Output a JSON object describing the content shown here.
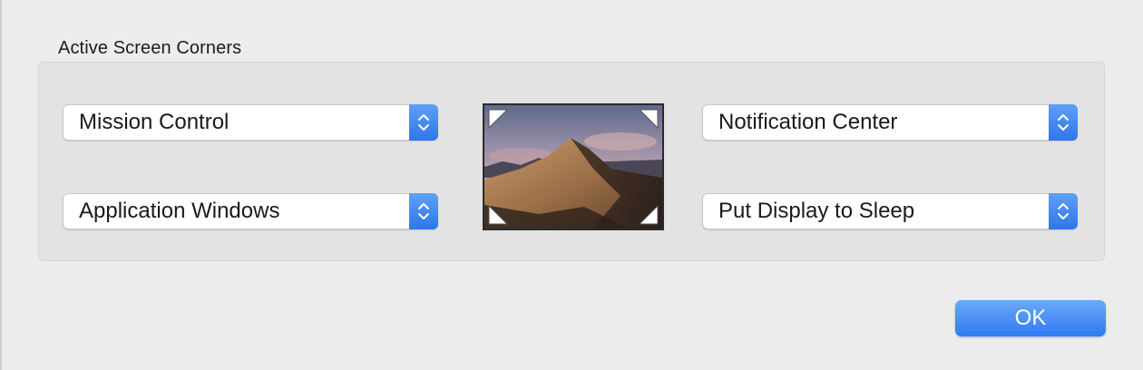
{
  "section": {
    "title": "Active Screen Corners"
  },
  "corners": {
    "top_left": "Mission Control",
    "top_right": "Notification Center",
    "bottom_left": "Application Windows",
    "bottom_right": "Put Display to Sleep"
  },
  "preview": {
    "icon": "desktop-wallpaper-preview"
  },
  "buttons": {
    "ok_label": "OK"
  },
  "colors": {
    "accent": "#2f7af0",
    "background": "#ececec",
    "group_background": "#e3e3e3"
  }
}
